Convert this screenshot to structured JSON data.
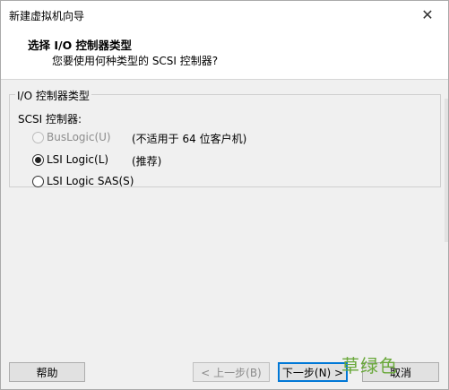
{
  "window": {
    "title": "新建虚拟机向导",
    "close_glyph": "✕"
  },
  "header": {
    "title": "选择 I/O 控制器类型",
    "subtitle": "您要使用何种类型的 SCSI 控制器?"
  },
  "group": {
    "legend": "I/O 控制器类型",
    "scsi_label": "SCSI 控制器:",
    "options": [
      {
        "label": "BusLogic(U)",
        "note": "(不适用于 64 位客户机)",
        "selected": false,
        "enabled": false
      },
      {
        "label": "LSI Logic(L)",
        "note": "(推荐)",
        "selected": true,
        "enabled": true
      },
      {
        "label": "LSI Logic SAS(S)",
        "note": "",
        "selected": false,
        "enabled": true
      }
    ]
  },
  "footer": {
    "help": "帮助",
    "back": "< 上一步(B)",
    "next": "下一步(N) >",
    "cancel": "取消",
    "watermark": "草绿色"
  }
}
